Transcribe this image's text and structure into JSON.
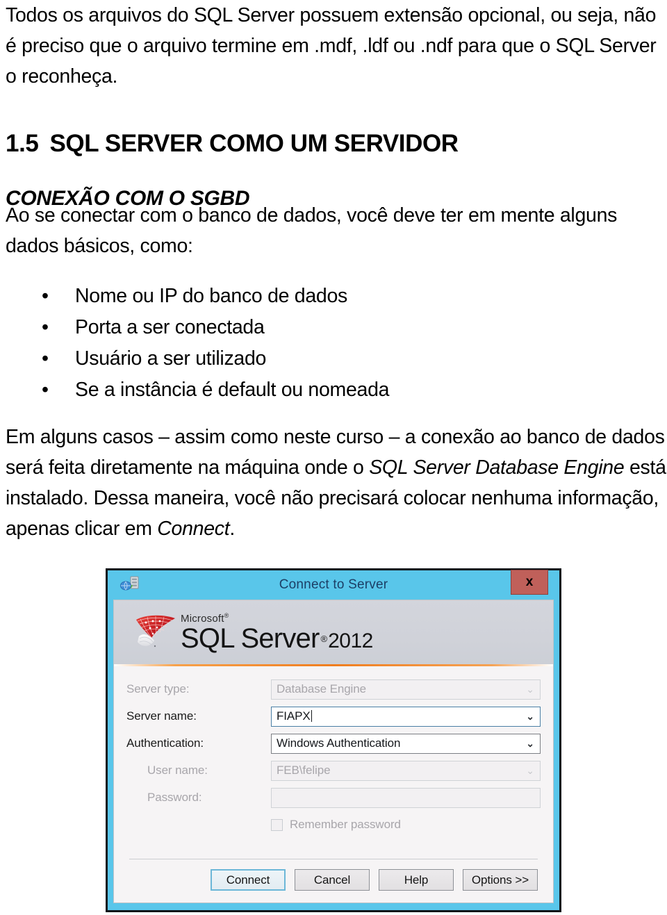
{
  "document": {
    "intro_paragraph": "Todos os arquivos do SQL Server possuem extensão opcional, ou seja, não é preciso que o arquivo termine em .mdf, .ldf ou .ndf para que o SQL Server o reconheça.",
    "section_number": "1.5",
    "section_title": "SQL SERVER COMO UM SERVIDOR",
    "subsection_title": "CONEXÃO COM O SGBD",
    "connect_paragraph": "Ao se conectar com o banco de dados, você deve ter em mente alguns dados básicos, como:",
    "bullet_marker": "•",
    "bullets": [
      "Nome ou IP do banco de dados",
      "Porta a ser conectada",
      "Usuário a ser utilizado",
      "Se a instância é default ou nomeada"
    ],
    "closing_paragraph": {
      "part1": "Em alguns casos – assim como neste curso – a conexão ao banco de dados será feita diretamente na máquina onde o ",
      "italic1": "SQL Server Database Engine",
      "part2": " está instalado. Dessa maneira, você não precisará colocar nenhuma informação, apenas clicar em ",
      "italic2": "Connect",
      "part3": "."
    }
  },
  "dialog": {
    "title": "Connect to Server",
    "titlebar_icon": "server-connection-icon",
    "close_label": "x",
    "brand": {
      "microsoft": "Microsoft",
      "registered_ms": "®",
      "product": "SQL Server",
      "registered_product": "®",
      "year": "2012",
      "logo_icon": "sql-server-logo-icon"
    },
    "fields": [
      {
        "label": "Server type:",
        "value": "Database Engine",
        "state": "disabled",
        "control": "combobox",
        "chevron": "⌄"
      },
      {
        "label": "Server name:",
        "value": "FIAPX",
        "state": "focused",
        "control": "combobox",
        "chevron": "⌄"
      },
      {
        "label": "Authentication:",
        "value": "Windows Authentication",
        "state": "normal",
        "control": "combobox",
        "chevron": "⌄"
      },
      {
        "label": "User name:",
        "value": "FEB\\felipe",
        "state": "disabled",
        "control": "combobox",
        "chevron": "⌄"
      },
      {
        "label": "Password:",
        "value": "",
        "state": "disabled",
        "control": "textbox",
        "chevron": ""
      }
    ],
    "remember_password": {
      "label": "Remember password",
      "checked": false
    },
    "buttons": [
      {
        "label": "Connect",
        "default": true
      },
      {
        "label": "Cancel",
        "default": false
      },
      {
        "label": "Help",
        "default": false
      },
      {
        "label": "Options >>",
        "default": false
      }
    ],
    "colors": {
      "titlebar": "#59c6ea",
      "close_button": "#c0605a",
      "accent_divider": "#f07d1e",
      "body": "#f6f4f5",
      "brand_panel": "#d0d2d9",
      "focus_border": "#4a7fa5",
      "title_text": "#1c3f66"
    }
  }
}
